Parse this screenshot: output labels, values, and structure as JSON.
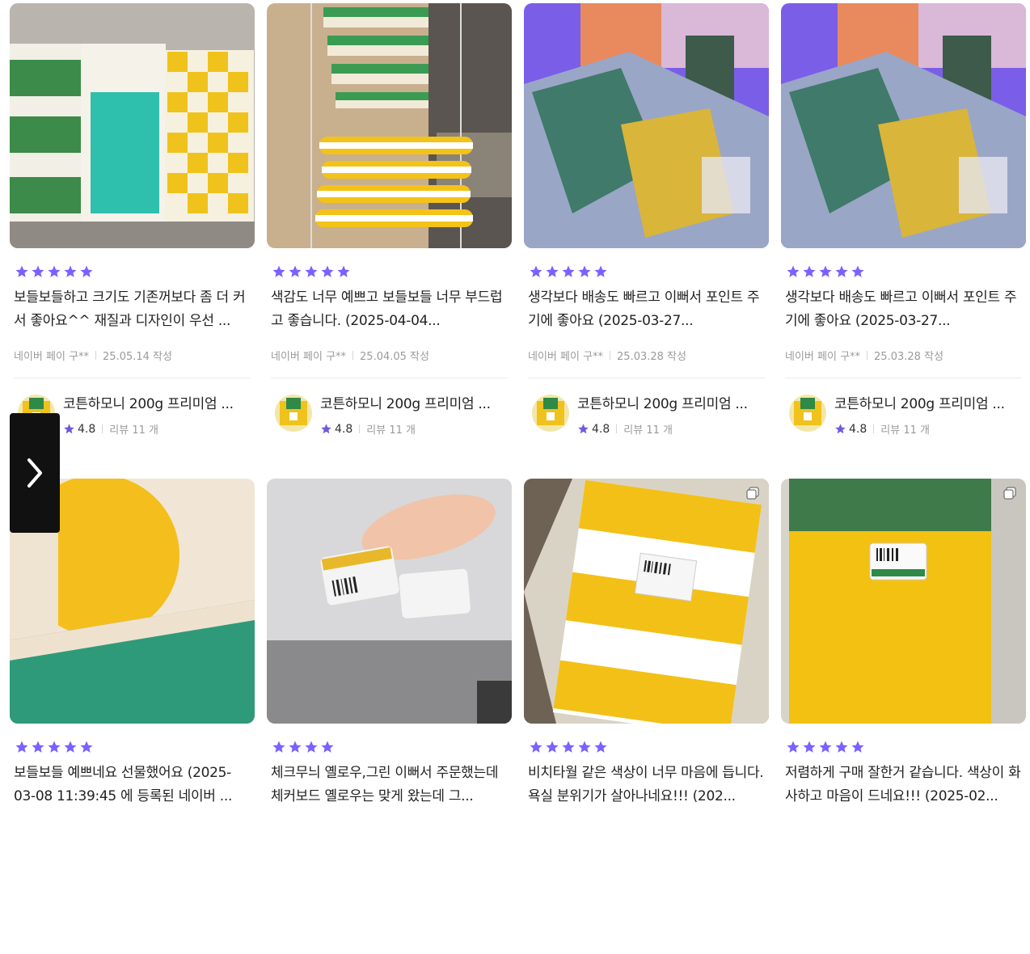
{
  "colors": {
    "star": "#7b61ff",
    "accent_purple": "#6e5bdc"
  },
  "reviews": [
    {
      "rating": 5,
      "text": "보들보들하고 크기도 기존꺼보다 좀 더 커서 좋아요^^ 재질과 디자인이 우선 ...",
      "author": "네이버 페이 구**",
      "date": "25.05.14 작성",
      "product": {
        "name": "코튼하모니 200g 프리미엄 ...",
        "rating": "4.8",
        "review_count": "리뷰 11 개"
      }
    },
    {
      "rating": 5,
      "text": "색감도 너무 예쁘고 보들보들 너무 부드럽고 좋습니다. (2025-04-04...",
      "author": "네이버 페이 구**",
      "date": "25.04.05 작성",
      "product": {
        "name": "코튼하모니 200g 프리미엄 ...",
        "rating": "4.8",
        "review_count": "리뷰 11 개"
      }
    },
    {
      "rating": 5,
      "text": "생각보다 배송도 빠르고 이뻐서 포인트 주기에 좋아요 (2025-03-27...",
      "author": "네이버 페이 구**",
      "date": "25.03.28 작성",
      "product": {
        "name": "코튼하모니 200g 프리미엄 ...",
        "rating": "4.8",
        "review_count": "리뷰 11 개"
      }
    },
    {
      "rating": 5,
      "text": "생각보다 배송도 빠르고 이뻐서 포인트 주기에 좋아요 (2025-03-27...",
      "author": "네이버 페이 구**",
      "date": "25.03.28 작성",
      "product": {
        "name": "코튼하모니 200g 프리미엄 ...",
        "rating": "4.8",
        "review_count": "리뷰 11 개"
      }
    },
    {
      "rating": 5,
      "text": "보들보들 예쁘네요 선물했어요 (2025-03-08 11:39:45 에 등록된 네이버 ...",
      "author": "",
      "date": "",
      "product": {
        "name": "",
        "rating": "",
        "review_count": ""
      }
    },
    {
      "rating": 4,
      "text": "체크무늬 옐로우,그린 이뻐서 주문했는데 체커보드 옐로우는 맞게 왔는데 그...",
      "author": "",
      "date": "",
      "product": {
        "name": "",
        "rating": "",
        "review_count": ""
      }
    },
    {
      "rating": 5,
      "text": "비치타월 같은 색상이 너무 마음에 듭니다. 욕실 분위기가 살아나네요!!! (202...",
      "author": "",
      "date": "",
      "product": {
        "name": "",
        "rating": "",
        "review_count": ""
      }
    },
    {
      "rating": 5,
      "text": "저렴하게 구매 잘한거 같습니다. 색상이 화사하고 마음이 드네요!!! (2025-02...",
      "author": "",
      "date": "",
      "product": {
        "name": "",
        "rating": "",
        "review_count": ""
      }
    }
  ],
  "nav": {
    "next_icon": "chevron-right-icon"
  }
}
